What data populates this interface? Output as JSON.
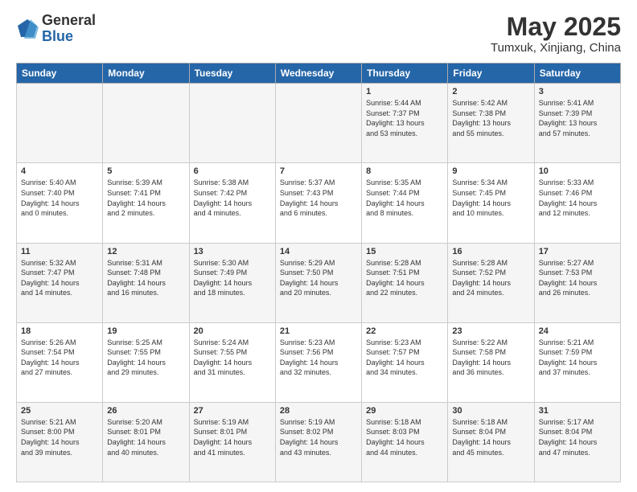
{
  "logo": {
    "general": "General",
    "blue": "Blue"
  },
  "title": "May 2025",
  "location": "Tumxuk, Xinjiang, China",
  "days_of_week": [
    "Sunday",
    "Monday",
    "Tuesday",
    "Wednesday",
    "Thursday",
    "Friday",
    "Saturday"
  ],
  "weeks": [
    [
      {
        "day": "",
        "info": ""
      },
      {
        "day": "",
        "info": ""
      },
      {
        "day": "",
        "info": ""
      },
      {
        "day": "",
        "info": ""
      },
      {
        "day": "1",
        "info": "Sunrise: 5:44 AM\nSunset: 7:37 PM\nDaylight: 13 hours\nand 53 minutes."
      },
      {
        "day": "2",
        "info": "Sunrise: 5:42 AM\nSunset: 7:38 PM\nDaylight: 13 hours\nand 55 minutes."
      },
      {
        "day": "3",
        "info": "Sunrise: 5:41 AM\nSunset: 7:39 PM\nDaylight: 13 hours\nand 57 minutes."
      }
    ],
    [
      {
        "day": "4",
        "info": "Sunrise: 5:40 AM\nSunset: 7:40 PM\nDaylight: 14 hours\nand 0 minutes."
      },
      {
        "day": "5",
        "info": "Sunrise: 5:39 AM\nSunset: 7:41 PM\nDaylight: 14 hours\nand 2 minutes."
      },
      {
        "day": "6",
        "info": "Sunrise: 5:38 AM\nSunset: 7:42 PM\nDaylight: 14 hours\nand 4 minutes."
      },
      {
        "day": "7",
        "info": "Sunrise: 5:37 AM\nSunset: 7:43 PM\nDaylight: 14 hours\nand 6 minutes."
      },
      {
        "day": "8",
        "info": "Sunrise: 5:35 AM\nSunset: 7:44 PM\nDaylight: 14 hours\nand 8 minutes."
      },
      {
        "day": "9",
        "info": "Sunrise: 5:34 AM\nSunset: 7:45 PM\nDaylight: 14 hours\nand 10 minutes."
      },
      {
        "day": "10",
        "info": "Sunrise: 5:33 AM\nSunset: 7:46 PM\nDaylight: 14 hours\nand 12 minutes."
      }
    ],
    [
      {
        "day": "11",
        "info": "Sunrise: 5:32 AM\nSunset: 7:47 PM\nDaylight: 14 hours\nand 14 minutes."
      },
      {
        "day": "12",
        "info": "Sunrise: 5:31 AM\nSunset: 7:48 PM\nDaylight: 14 hours\nand 16 minutes."
      },
      {
        "day": "13",
        "info": "Sunrise: 5:30 AM\nSunset: 7:49 PM\nDaylight: 14 hours\nand 18 minutes."
      },
      {
        "day": "14",
        "info": "Sunrise: 5:29 AM\nSunset: 7:50 PM\nDaylight: 14 hours\nand 20 minutes."
      },
      {
        "day": "15",
        "info": "Sunrise: 5:28 AM\nSunset: 7:51 PM\nDaylight: 14 hours\nand 22 minutes."
      },
      {
        "day": "16",
        "info": "Sunrise: 5:28 AM\nSunset: 7:52 PM\nDaylight: 14 hours\nand 24 minutes."
      },
      {
        "day": "17",
        "info": "Sunrise: 5:27 AM\nSunset: 7:53 PM\nDaylight: 14 hours\nand 26 minutes."
      }
    ],
    [
      {
        "day": "18",
        "info": "Sunrise: 5:26 AM\nSunset: 7:54 PM\nDaylight: 14 hours\nand 27 minutes."
      },
      {
        "day": "19",
        "info": "Sunrise: 5:25 AM\nSunset: 7:55 PM\nDaylight: 14 hours\nand 29 minutes."
      },
      {
        "day": "20",
        "info": "Sunrise: 5:24 AM\nSunset: 7:55 PM\nDaylight: 14 hours\nand 31 minutes."
      },
      {
        "day": "21",
        "info": "Sunrise: 5:23 AM\nSunset: 7:56 PM\nDaylight: 14 hours\nand 32 minutes."
      },
      {
        "day": "22",
        "info": "Sunrise: 5:23 AM\nSunset: 7:57 PM\nDaylight: 14 hours\nand 34 minutes."
      },
      {
        "day": "23",
        "info": "Sunrise: 5:22 AM\nSunset: 7:58 PM\nDaylight: 14 hours\nand 36 minutes."
      },
      {
        "day": "24",
        "info": "Sunrise: 5:21 AM\nSunset: 7:59 PM\nDaylight: 14 hours\nand 37 minutes."
      }
    ],
    [
      {
        "day": "25",
        "info": "Sunrise: 5:21 AM\nSunset: 8:00 PM\nDaylight: 14 hours\nand 39 minutes."
      },
      {
        "day": "26",
        "info": "Sunrise: 5:20 AM\nSunset: 8:01 PM\nDaylight: 14 hours\nand 40 minutes."
      },
      {
        "day": "27",
        "info": "Sunrise: 5:19 AM\nSunset: 8:01 PM\nDaylight: 14 hours\nand 41 minutes."
      },
      {
        "day": "28",
        "info": "Sunrise: 5:19 AM\nSunset: 8:02 PM\nDaylight: 14 hours\nand 43 minutes."
      },
      {
        "day": "29",
        "info": "Sunrise: 5:18 AM\nSunset: 8:03 PM\nDaylight: 14 hours\nand 44 minutes."
      },
      {
        "day": "30",
        "info": "Sunrise: 5:18 AM\nSunset: 8:04 PM\nDaylight: 14 hours\nand 45 minutes."
      },
      {
        "day": "31",
        "info": "Sunrise: 5:17 AM\nSunset: 8:04 PM\nDaylight: 14 hours\nand 47 minutes."
      }
    ]
  ]
}
